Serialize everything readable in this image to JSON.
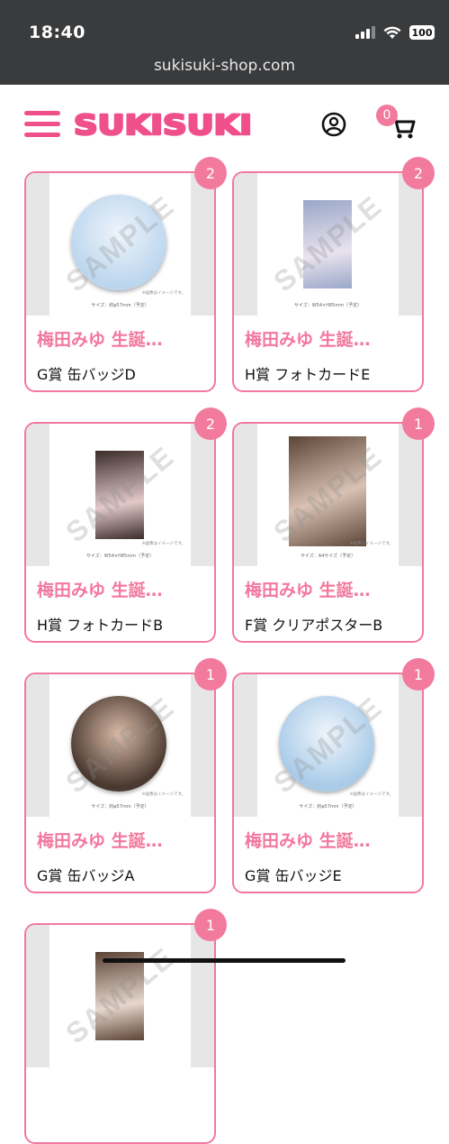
{
  "status_bar": {
    "time": "18:40",
    "battery": "100",
    "url": "sukisuki-shop.com"
  },
  "header": {
    "logo_text": "SUKISUKI",
    "cart_count": "0",
    "brand_color": "#f0508a",
    "icons": [
      "hamburger-menu-icon",
      "user-account-icon",
      "shopping-cart-icon"
    ]
  },
  "products": [
    {
      "badge": "2",
      "title": "梅田みゆ 生誕…",
      "subtitle": "G賞 缶バッジD",
      "type": "badge",
      "size_text": "サイズ：約φ57mm（予定）",
      "note": "※画像はイメージです。",
      "art_colors": [
        "#bcd6ee",
        "#eef4fb"
      ]
    },
    {
      "badge": "2",
      "title": "梅田みゆ 生誕…",
      "subtitle": "H賞 フォトカードE",
      "type": "photo",
      "size_text": "サイズ：W54×H85mm（予定）",
      "note": "",
      "art_colors": [
        "#9aa7c8",
        "#e9e3ee"
      ]
    },
    {
      "badge": "2",
      "title": "梅田みゆ 生誕…",
      "subtitle": "H賞 フォトカードB",
      "type": "photo",
      "size_text": "サイズ：W54×H85mm（予定）",
      "note": "※画像はイメージです。",
      "art_colors": [
        "#3b2c2a",
        "#e3c9c9"
      ]
    },
    {
      "badge": "1",
      "title": "梅田みゆ 生誕…",
      "subtitle": "F賞 クリアポスターB",
      "type": "poster",
      "size_text": "サイズ：A4サイズ（予定）",
      "note": "※画像はイメージです。",
      "art_colors": [
        "#5b4335",
        "#d9c2b4"
      ]
    },
    {
      "badge": "1",
      "title": "梅田みゆ 生誕…",
      "subtitle": "G賞 缶バッジA",
      "type": "badge",
      "size_text": "サイズ：約φ57mm（予定）",
      "note": "※画像はイメージです。",
      "art_colors": [
        "#4a3930",
        "#d8b9a6"
      ]
    },
    {
      "badge": "1",
      "title": "梅田みゆ 生誕…",
      "subtitle": "G賞 缶バッジE",
      "type": "badge",
      "size_text": "サイズ：約φ57mm（予定）",
      "note": "※画像はイメージです。",
      "art_colors": [
        "#a9cbe8",
        "#eef5fb"
      ]
    },
    {
      "badge": "1",
      "title": "",
      "subtitle": "",
      "type": "photo",
      "size_text": "",
      "note": "",
      "art_colors": [
        "#5b4335",
        "#e7d7cc"
      ]
    }
  ],
  "watermark": "SAMPLE"
}
